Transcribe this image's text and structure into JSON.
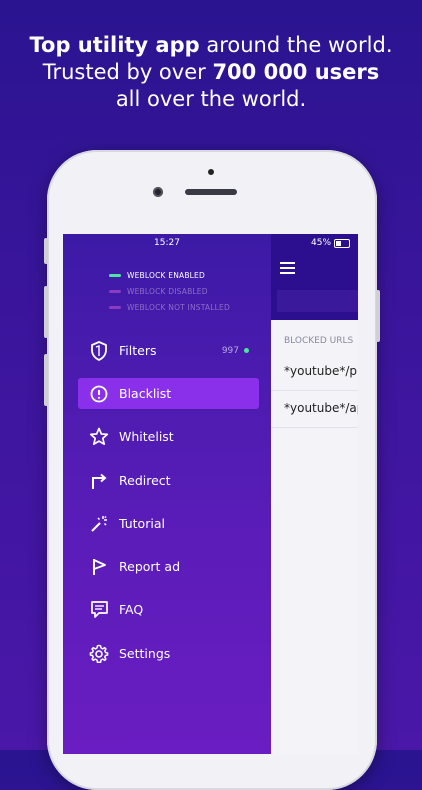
{
  "headline": {
    "line1_bold": "Top utility app",
    "line1_rest": " around the world.",
    "line2_start": "Trusted by over ",
    "line2_bold": "700 000 users",
    "line3": "all over the world."
  },
  "status_bar": {
    "time": "15:27",
    "battery": "45%"
  },
  "legend": {
    "enabled": "WEBLOCK ENABLED",
    "disabled": "WEBLOCK DISABLED",
    "not_installed": "WEBLOCK NOT INSTALLED"
  },
  "colors": {
    "enabled": "#4de6a0",
    "disabled": "#8a3cc0",
    "not_installed": "#8a3cc0",
    "active": "#8b30ea"
  },
  "menu": [
    {
      "label": "Filters",
      "icon": "shield-icon",
      "count": "997"
    },
    {
      "label": "Blacklist",
      "icon": "alert-circle-icon",
      "active": true
    },
    {
      "label": "Whitelist",
      "icon": "star-icon"
    },
    {
      "label": "Redirect",
      "icon": "redirect-arrow-icon"
    },
    {
      "label": "Tutorial",
      "icon": "magic-wand-icon"
    },
    {
      "label": "Report ad",
      "icon": "flag-icon"
    },
    {
      "label": "FAQ",
      "icon": "chat-icon"
    },
    {
      "label": "Settings",
      "icon": "gear-icon"
    }
  ],
  "main": {
    "section_label": "BLOCKED URLS",
    "urls": [
      "*youtube*/p",
      "*youtube*/ap"
    ]
  }
}
